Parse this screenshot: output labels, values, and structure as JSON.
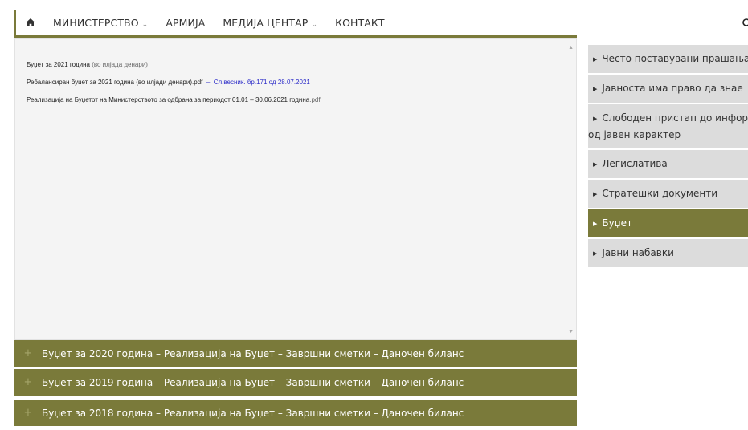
{
  "nav": {
    "items": [
      {
        "label": "МИНИСТЕРСТВО",
        "dropdown": true
      },
      {
        "label": "АРМИЈА",
        "dropdown": false
      },
      {
        "label": "МЕДИЈА ЦЕНТАР",
        "dropdown": true
      },
      {
        "label": "КОНТАКТ",
        "dropdown": false
      }
    ],
    "icons": {
      "home": "home-icon",
      "search": "search-icon"
    }
  },
  "main": {
    "row1": {
      "title": "Буџет за 2021 година",
      "note": "(во илјада денари)"
    },
    "row2": {
      "title": "Ребалансиран буџет за 2021 година (во илјади денари).pdf",
      "sep": "–",
      "link": "Сл.весник. бр.171 од 28.07.2021"
    },
    "row3": {
      "title": "Реализација на Буџетот на Министерството за одбрана за периодот 01.01 – 30.06.2021 година",
      "ext": ".pdf"
    }
  },
  "accordion": [
    {
      "label": "Буџет за 2020 година – Реализација на Буџет – Завршни сметки – Даночен биланс"
    },
    {
      "label": "Буџет за 2019 година – Реализација на Буџет – Завршни сметки – Даночен биланс"
    },
    {
      "label": "Буџет за 2018 година – Реализација на Буџет – Завршни сметки – Даночен биланс"
    }
  ],
  "sidebar": {
    "items": [
      {
        "label": "Често поставувани прашања"
      },
      {
        "label": "Јавноста има право да знае"
      },
      {
        "label1": "Слободен пристап до информации",
        "label2": "од јавен карактер"
      },
      {
        "label": "Легислатива"
      },
      {
        "label": "Стратешки документи"
      },
      {
        "label": "Буџет",
        "active": true
      },
      {
        "label": "Јавни набавки"
      }
    ]
  },
  "colors": {
    "accent": "#7a7a3a",
    "sidebar_bg": "#dcdcdc",
    "link": "#2a2ac8"
  }
}
